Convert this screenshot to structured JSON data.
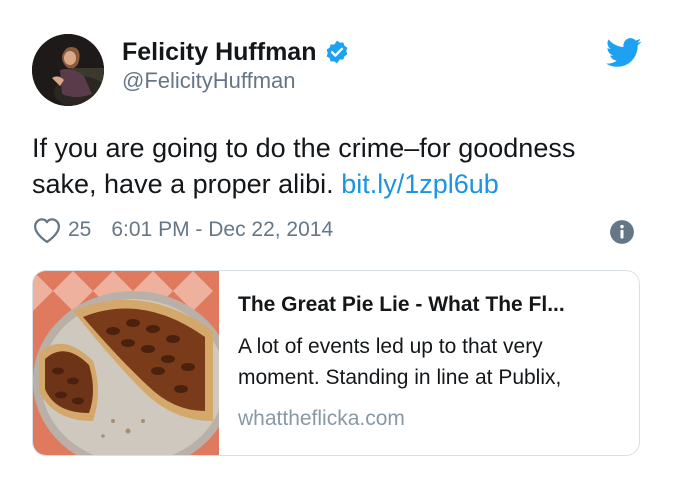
{
  "author": {
    "display_name": "Felicity Huffman",
    "handle": "@FelicityHuffman",
    "verified": true
  },
  "tweet": {
    "text_line1": "If you are going to do the crime–for goodness",
    "text_line2": "sake, have a proper alibi.",
    "link": "bit.ly/1zpl6ub",
    "likes": "25",
    "timestamp": "6:01 PM - Dec 22, 2014"
  },
  "card": {
    "title": "The Great Pie Lie - What The Fl...",
    "description_line1": "A lot of events led up to that very",
    "description_line2": "moment. Standing in line at Publix,",
    "domain": "whattheflicka.com"
  },
  "icons": {
    "verified": "verified-badge-icon",
    "bird": "twitter-bird-icon",
    "heart": "heart-icon",
    "info": "info-icon"
  },
  "colors": {
    "brand_blue": "#1da1f2",
    "link_blue": "#1b95e0",
    "secondary_text": "#657786",
    "card_border": "#d8dfe5"
  }
}
